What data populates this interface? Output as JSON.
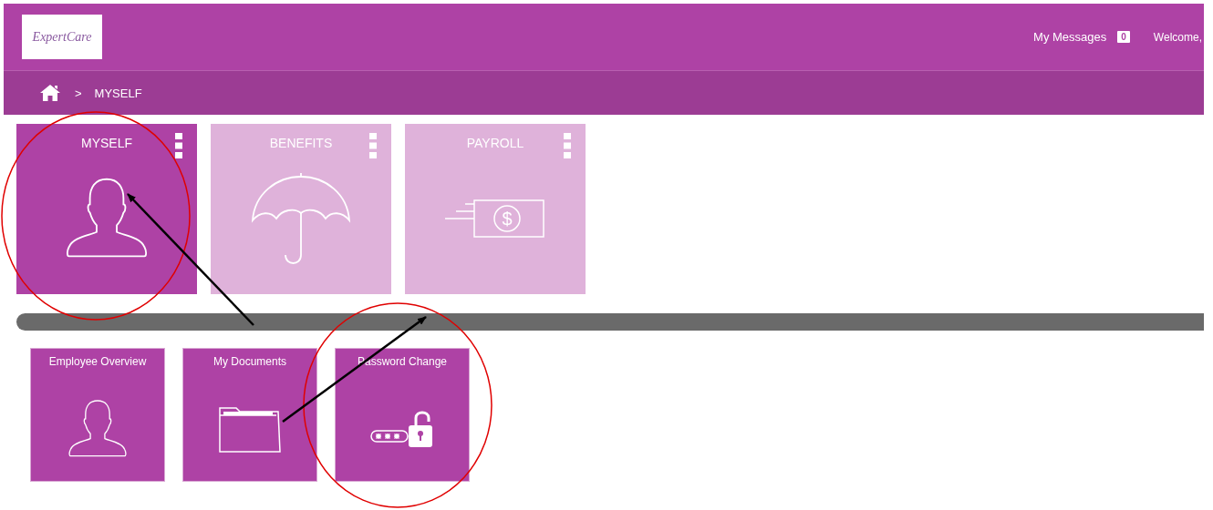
{
  "header": {
    "logo": "ExpertCare",
    "messages_label": "My Messages",
    "messages_count": "0",
    "welcome": "Welcome,"
  },
  "breadcrumb": {
    "separator": ">",
    "current": "MYSELF"
  },
  "tiles": [
    {
      "label": "MYSELF",
      "kind": "person",
      "selected": true
    },
    {
      "label": "BENEFITS",
      "kind": "umbrella",
      "selected": false
    },
    {
      "label": "PAYROLL",
      "kind": "money",
      "symbol": "$",
      "selected": false
    }
  ],
  "subtiles": [
    {
      "label": "Employee Overview",
      "kind": "person"
    },
    {
      "label": "My Documents",
      "kind": "folder"
    },
    {
      "label": "Password Change",
      "kind": "lock"
    }
  ]
}
